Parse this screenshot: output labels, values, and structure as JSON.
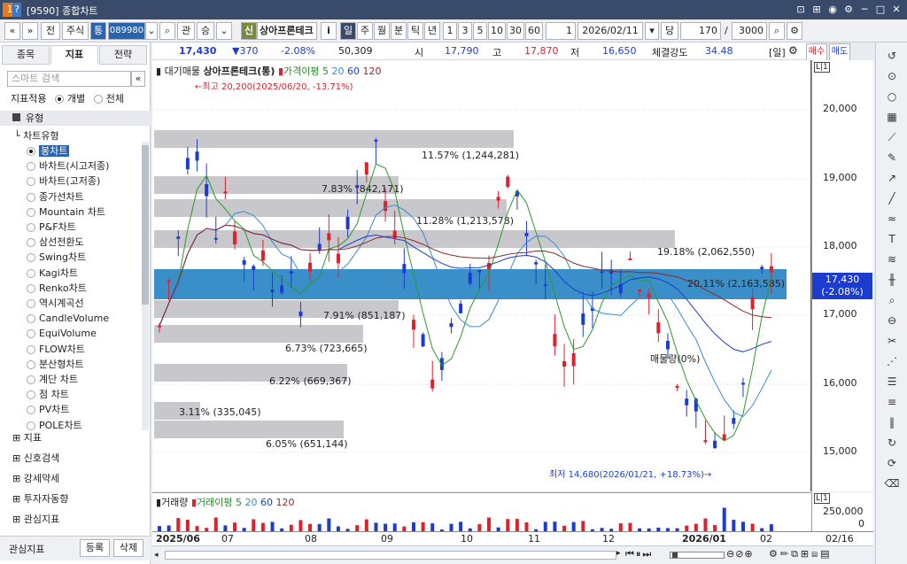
{
  "window": {
    "num": "1",
    "help": "?",
    "title": "[9590] 종합차트"
  },
  "toolbar": {
    "nav1": "«",
    "nav2": "»",
    "market1": "전",
    "market2": "주식",
    "tong": "통",
    "code": "089980",
    "search": "⌕",
    "b1": "관",
    "b2": "승",
    "shin": "신",
    "name": "상아프론테크",
    "info": "i",
    "periods": [
      "일",
      "주",
      "월",
      "분",
      "틱",
      "년"
    ],
    "nums": [
      "1",
      "3",
      "5",
      "10",
      "30",
      "60"
    ],
    "one": "1",
    "date": "2026/02/11",
    "dang": "당",
    "count": "170",
    "slash": "/",
    "total": "3000"
  },
  "left": {
    "tabs": [
      "종목",
      "지표",
      "전략"
    ],
    "search_placeholder": "스마트 검색",
    "apply_label": "지표적용",
    "apply_opt1": "개별",
    "apply_opt2": "전체",
    "section": "유형",
    "subsection": "차트유형",
    "chart_types": [
      "봉차트",
      "바차트(시고저종)",
      "바차트(고저종)",
      "종가선차트",
      "Mountain 차트",
      "P&F차트",
      "삼선전환도",
      "Swing차트",
      "Kagi차트",
      "Renko차트",
      "역시계곡선",
      "CandleVolume",
      "EquiVolume",
      "FLOW차트",
      "분산형차트",
      "계단 차트",
      "점 차트",
      "PV차트",
      "POLE차트"
    ],
    "selected": "봉차트",
    "groups": [
      "지표",
      "신호검색",
      "강세약세",
      "투자자동향",
      "관심지표"
    ],
    "footer_label": "관심지표",
    "footer_btn1": "등록",
    "footer_btn2": "삭제"
  },
  "info": {
    "price": "17,430",
    "change": "▼370",
    "pct": "-2.08%",
    "vol": "50,309",
    "open_l": "시",
    "open": "17,790",
    "high_l": "고",
    "high": "17,870",
    "low_l": "저",
    "low": "16,650",
    "str_l": "체결강도",
    "str": "34.48",
    "period": "[일]",
    "sell": "매수",
    "buy": "매도"
  },
  "legend": {
    "t1": "대기매물",
    "t2": "상아프론테크(통)",
    "t3": "가격이평",
    "t3n": "5",
    "n20": "20",
    "n60": "60",
    "n120": "120"
  },
  "annot": {
    "max": "←최고 20,200(2025/06/20, -13.71%)",
    "min": "최저 14,680(2026/01/21, +18.73%)→",
    "ratio": "매물량(0%)"
  },
  "profile": [
    {
      "label": "11.57% (1,244,281)"
    },
    {
      "label": "7.83% (842,171)"
    },
    {
      "label": "11.28% (1,213,578)"
    },
    {
      "label": "19.18% (2,062,550)"
    },
    {
      "label": "20.11% (2,163,585)"
    },
    {
      "label": "7.91% (851,187)"
    },
    {
      "label": "6.73% (723,665)"
    },
    {
      "label": "6.22% (669,367)"
    },
    {
      "label": "3.11% (335,045)"
    },
    {
      "label": "6.05% (651,144)"
    }
  ],
  "yaxis": {
    "ticks": [
      "20,000",
      "19,000",
      "18,000",
      "17,000",
      "16,000",
      "15,000"
    ],
    "current": "17,430",
    "current_pct": "(-2.08%)"
  },
  "volume": {
    "label": "거래량",
    "ma": "거래이평",
    "man": "5",
    "n20": "20",
    "n60": "60",
    "n120": "120",
    "tick": "250,000",
    "tick0": "0"
  },
  "xaxis": {
    "labels": [
      "2025/06",
      "07",
      "08",
      "09",
      "10",
      "11",
      "12",
      "2026/01",
      "02"
    ],
    "last": "02/16"
  },
  "colors": {
    "up": "#e0202a",
    "down": "#1c3cd0",
    "accent": "#2a64b0"
  }
}
